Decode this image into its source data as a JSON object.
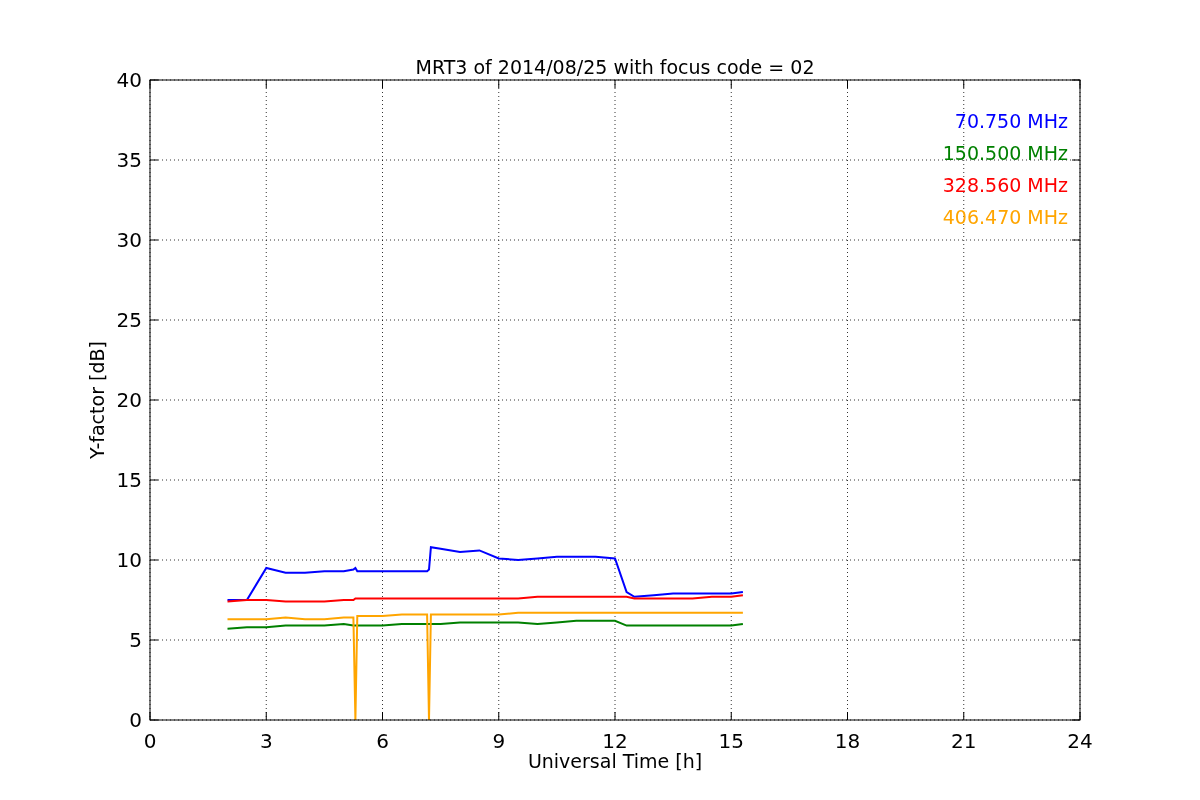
{
  "chart_data": {
    "type": "line",
    "title": "MRT3 of 2014/08/25 with focus code = 02",
    "xlabel": "Universal Time [h]",
    "ylabel": "Y-factor [dB]",
    "x": [
      2,
      2.5,
      3,
      3.5,
      4,
      4.5,
      5,
      5.25,
      5.3,
      5.35,
      5.5,
      6,
      6.5,
      7,
      7.15,
      7.2,
      7.25,
      7.5,
      8,
      8.5,
      9,
      9.5,
      10,
      10.5,
      11,
      11.5,
      12,
      12.3,
      12.5,
      13,
      13.5,
      14,
      14.5,
      15,
      15.3
    ],
    "series": [
      {
        "name": "70.750 MHz",
        "color": "#0000ff",
        "values": [
          7.5,
          7.5,
          9.5,
          9.2,
          9.2,
          9.3,
          9.3,
          9.4,
          9.5,
          9.3,
          9.3,
          9.3,
          9.3,
          9.3,
          9.3,
          9.4,
          10.8,
          10.7,
          10.5,
          10.6,
          10.1,
          10.0,
          10.1,
          10.2,
          10.2,
          10.2,
          10.1,
          8.0,
          7.7,
          7.8,
          7.9,
          7.9,
          7.9,
          7.9,
          8.0
        ]
      },
      {
        "name": "150.500 MHz",
        "color": "#008000",
        "values": [
          5.7,
          5.8,
          5.8,
          5.9,
          5.9,
          5.9,
          6.0,
          5.9,
          5.9,
          5.9,
          5.9,
          5.9,
          6.0,
          6.0,
          6.0,
          6.0,
          6.0,
          6.0,
          6.1,
          6.1,
          6.1,
          6.1,
          6.0,
          6.1,
          6.2,
          6.2,
          6.2,
          5.9,
          5.9,
          5.9,
          5.9,
          5.9,
          5.9,
          5.9,
          6.0
        ]
      },
      {
        "name": "328.560 MHz",
        "color": "#ff0000",
        "values": [
          7.4,
          7.5,
          7.5,
          7.4,
          7.4,
          7.4,
          7.5,
          7.5,
          7.6,
          7.6,
          7.6,
          7.6,
          7.6,
          7.6,
          7.6,
          7.6,
          7.6,
          7.6,
          7.6,
          7.6,
          7.6,
          7.6,
          7.7,
          7.7,
          7.7,
          7.7,
          7.7,
          7.7,
          7.6,
          7.6,
          7.6,
          7.6,
          7.7,
          7.7,
          7.8
        ]
      },
      {
        "name": "406.470 MHz",
        "color": "#ffa500",
        "values": [
          6.3,
          6.3,
          6.3,
          6.4,
          6.3,
          6.3,
          6.4,
          6.4,
          0,
          6.5,
          6.5,
          6.5,
          6.6,
          6.6,
          6.6,
          0,
          6.6,
          6.6,
          6.6,
          6.6,
          6.6,
          6.7,
          6.7,
          6.7,
          6.7,
          6.7,
          6.7,
          6.7,
          6.7,
          6.7,
          6.7,
          6.7,
          6.7,
          6.7,
          6.7
        ]
      }
    ],
    "xlim": [
      0,
      24
    ],
    "ylim": [
      0,
      40
    ],
    "xticks": [
      0,
      3,
      6,
      9,
      12,
      15,
      18,
      21,
      24
    ],
    "yticks": [
      0,
      5,
      10,
      15,
      20,
      25,
      30,
      35,
      40
    ],
    "grid": true
  }
}
